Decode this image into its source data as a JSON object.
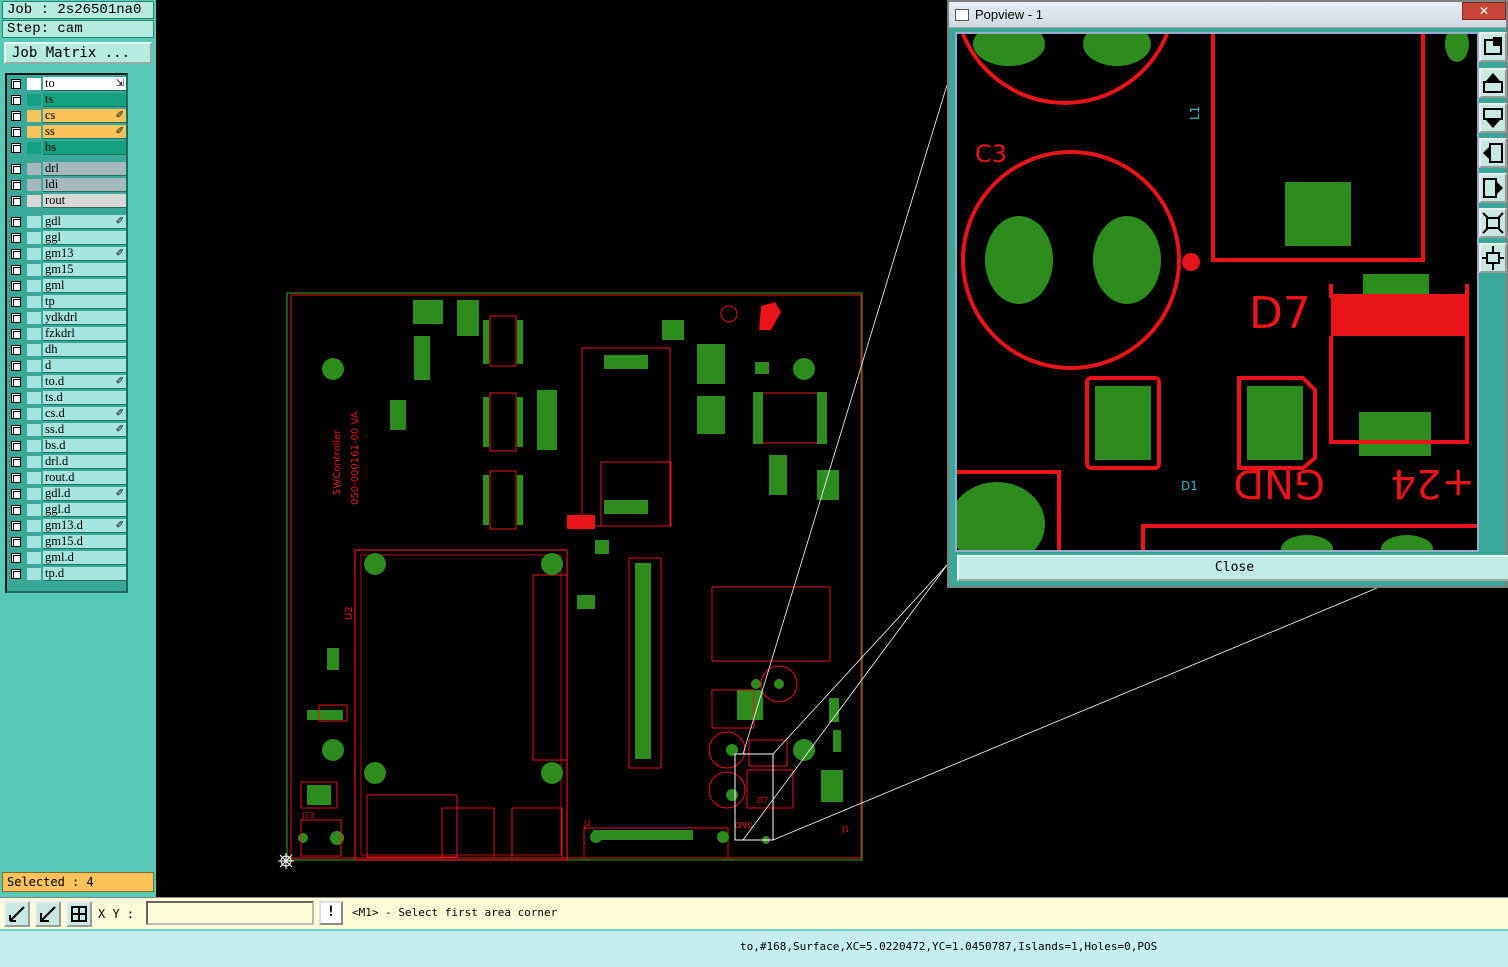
{
  "job": {
    "job_label": "Job : 2s26501na0",
    "step_label": "Step: cam",
    "matrix_button": "Job Matrix ..."
  },
  "layers": [
    {
      "name": "to",
      "color": "#ffffff",
      "mark": "⇲"
    },
    {
      "name": "ts",
      "color": "#12a080",
      "mark": ""
    },
    {
      "name": "cs",
      "color": "#f7c35a",
      "mark": "✐"
    },
    {
      "name": "ss",
      "color": "#f7c35a",
      "mark": "✐"
    },
    {
      "name": "bs",
      "color": "#12a080",
      "mark": ""
    },
    {
      "name": "drl",
      "color": "#a6b8c0",
      "mark": ""
    },
    {
      "name": "ldi",
      "color": "#a6b8c0",
      "mark": ""
    },
    {
      "name": "rout",
      "color": "#d8d8d8",
      "mark": ""
    },
    {
      "name": "gdl",
      "color": "#a6e4e0",
      "mark": "✐"
    },
    {
      "name": "ggl",
      "color": "#a6e4e0",
      "mark": ""
    },
    {
      "name": "gm13",
      "color": "#a6e4e0",
      "mark": "✐"
    },
    {
      "name": "gm15",
      "color": "#a6e4e0",
      "mark": ""
    },
    {
      "name": "gml",
      "color": "#a6e4e0",
      "mark": ""
    },
    {
      "name": "tp",
      "color": "#a6e4e0",
      "mark": ""
    },
    {
      "name": "ydkdrl",
      "color": "#a6e4e0",
      "mark": ""
    },
    {
      "name": "fzkdrl",
      "color": "#a6e4e0",
      "mark": ""
    },
    {
      "name": "dh",
      "color": "#a6e4e0",
      "mark": ""
    },
    {
      "name": "d",
      "color": "#a6e4e0",
      "mark": ""
    },
    {
      "name": "to.d",
      "color": "#a6e4e0",
      "mark": "✐"
    },
    {
      "name": "ts.d",
      "color": "#a6e4e0",
      "mark": ""
    },
    {
      "name": "cs.d",
      "color": "#a6e4e0",
      "mark": "✐"
    },
    {
      "name": "ss.d",
      "color": "#a6e4e0",
      "mark": "✐"
    },
    {
      "name": "bs.d",
      "color": "#a6e4e0",
      "mark": ""
    },
    {
      "name": "drl.d",
      "color": "#a6e4e0",
      "mark": ""
    },
    {
      "name": "rout.d",
      "color": "#a6e4e0",
      "mark": ""
    },
    {
      "name": "gdl.d",
      "color": "#a6e4e0",
      "mark": "✐"
    },
    {
      "name": "ggl.d",
      "color": "#a6e4e0",
      "mark": ""
    },
    {
      "name": "gm13.d",
      "color": "#a6e4e0",
      "mark": "✐"
    },
    {
      "name": "gm15.d",
      "color": "#a6e4e0",
      "mark": ""
    },
    {
      "name": "gml.d",
      "color": "#a6e4e0",
      "mark": ""
    },
    {
      "name": "tp.d",
      "color": "#a6e4e0",
      "mark": ""
    }
  ],
  "selected": "Selected : 4",
  "board": {
    "silk_title": "SWController",
    "silk_part": "050-000161-00 VA",
    "labels": [
      "U2",
      "J2",
      "J1",
      "D7",
      "GND",
      "J13"
    ]
  },
  "popview": {
    "title": "Popview - 1",
    "close_x": "✕",
    "close_button": "Close",
    "labels": {
      "c3": "C3",
      "d7": "D7",
      "gnd": "GND",
      "p24": "+24",
      "l1": "L1",
      "d1": "D1"
    }
  },
  "command": {
    "xy_label": "X Y :",
    "xy_value": "",
    "excl": "!",
    "prompt": "<M1> - Select first area corner"
  },
  "status": "to,#168,Surface,XC=5.0220472,YC=1.0450787,Islands=1,Holes=0,POS",
  "colors": {
    "panel": "#56c9b7",
    "pad": "#2e8b1e",
    "trace": "#e8141a",
    "status": "#c6eef0"
  }
}
